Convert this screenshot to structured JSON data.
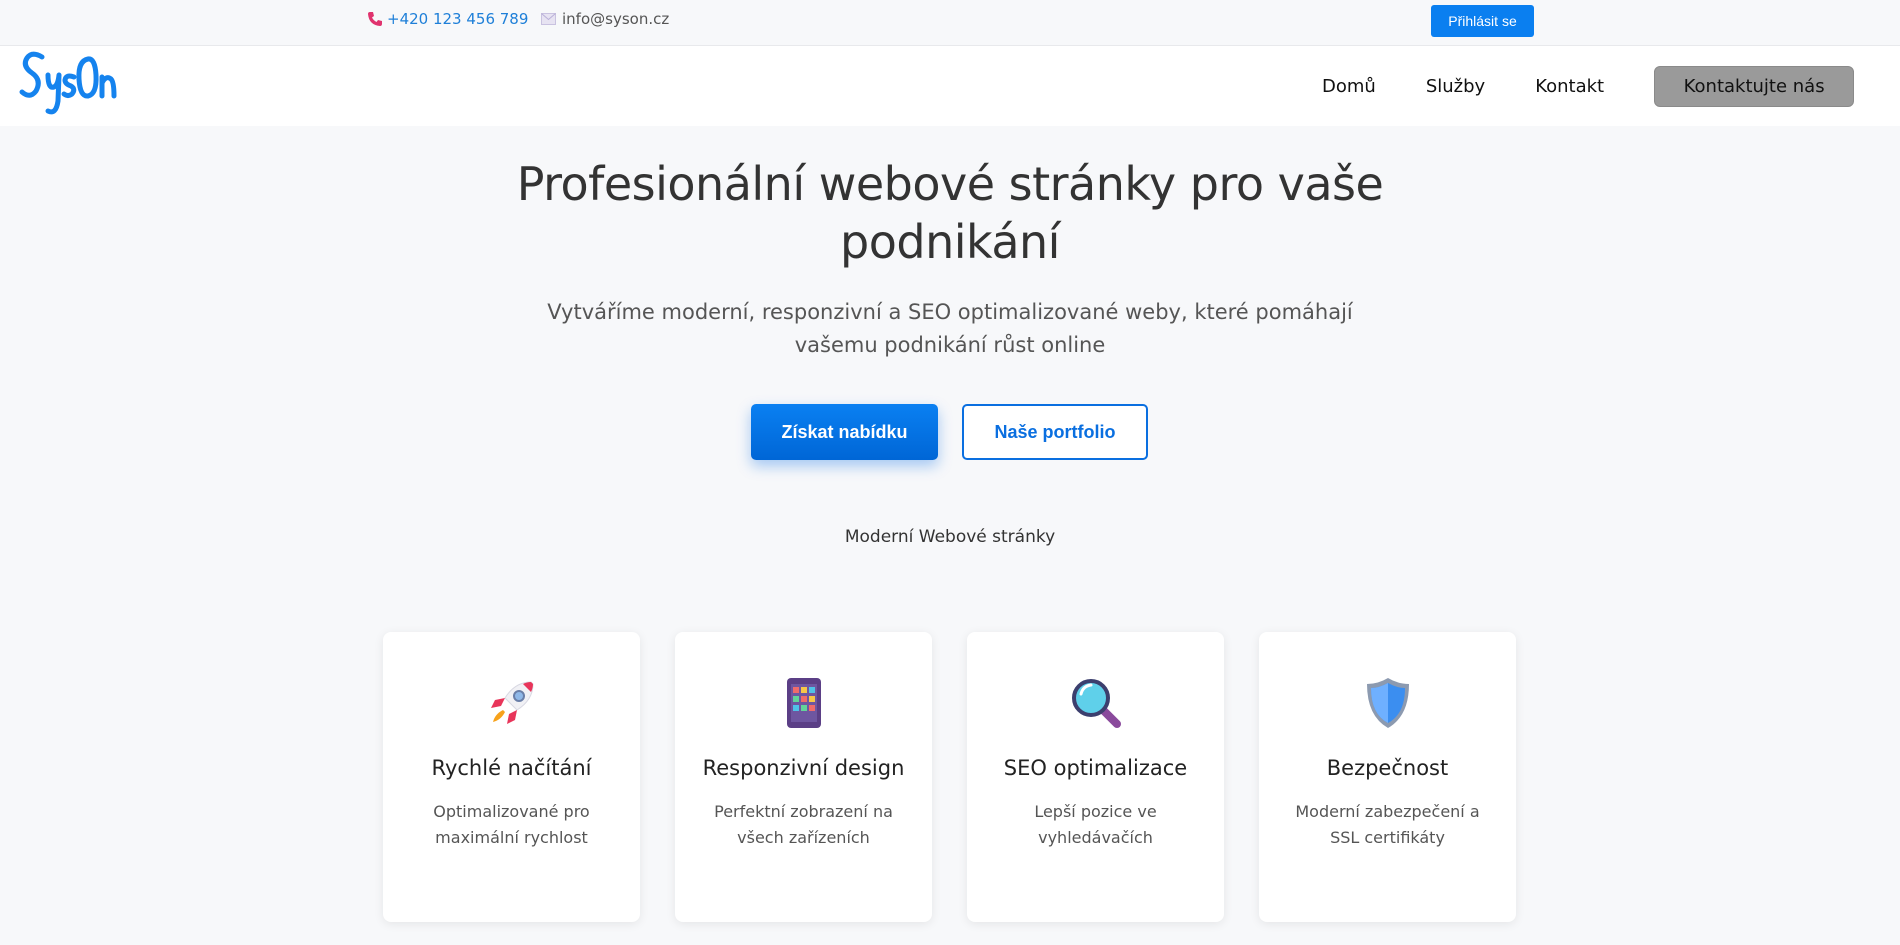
{
  "topbar": {
    "phone": "+420 123 456 789",
    "email": "info@syson.cz",
    "login_label": "Přihlásit se"
  },
  "header": {
    "logo_text": "SysOn",
    "nav": [
      "Domů",
      "Služby",
      "Kontakt"
    ],
    "cta_label": "Kontaktujte nás"
  },
  "hero": {
    "title": "Profesionální webové stránky pro vaše podnikání",
    "subtitle": "Vytváříme moderní, responzivní a SEO optimalizované weby, které pomáhají vašemu podnikání růst online",
    "primary_button": "Získat nabídku",
    "secondary_button": "Naše portfolio",
    "tagline": "Moderní Webové stránky"
  },
  "features": [
    {
      "icon": "rocket-icon",
      "title": "Rychlé načítání",
      "text": "Optimalizované pro maximální rychlost"
    },
    {
      "icon": "tablet-icon",
      "title": "Responzivní design",
      "text": "Perfektní zobrazení na všech zařízeních"
    },
    {
      "icon": "magnifier-icon",
      "title": "SEO optimalizace",
      "text": "Lepší pozice ve vyhledávačích"
    },
    {
      "icon": "shield-icon",
      "title": "Bezpečnost",
      "text": "Moderní zabezpečení a SSL certifikáty"
    }
  ],
  "colors": {
    "accent": "#0a7ff0",
    "logo": "#1583ee",
    "background": "#f7f8fa"
  }
}
